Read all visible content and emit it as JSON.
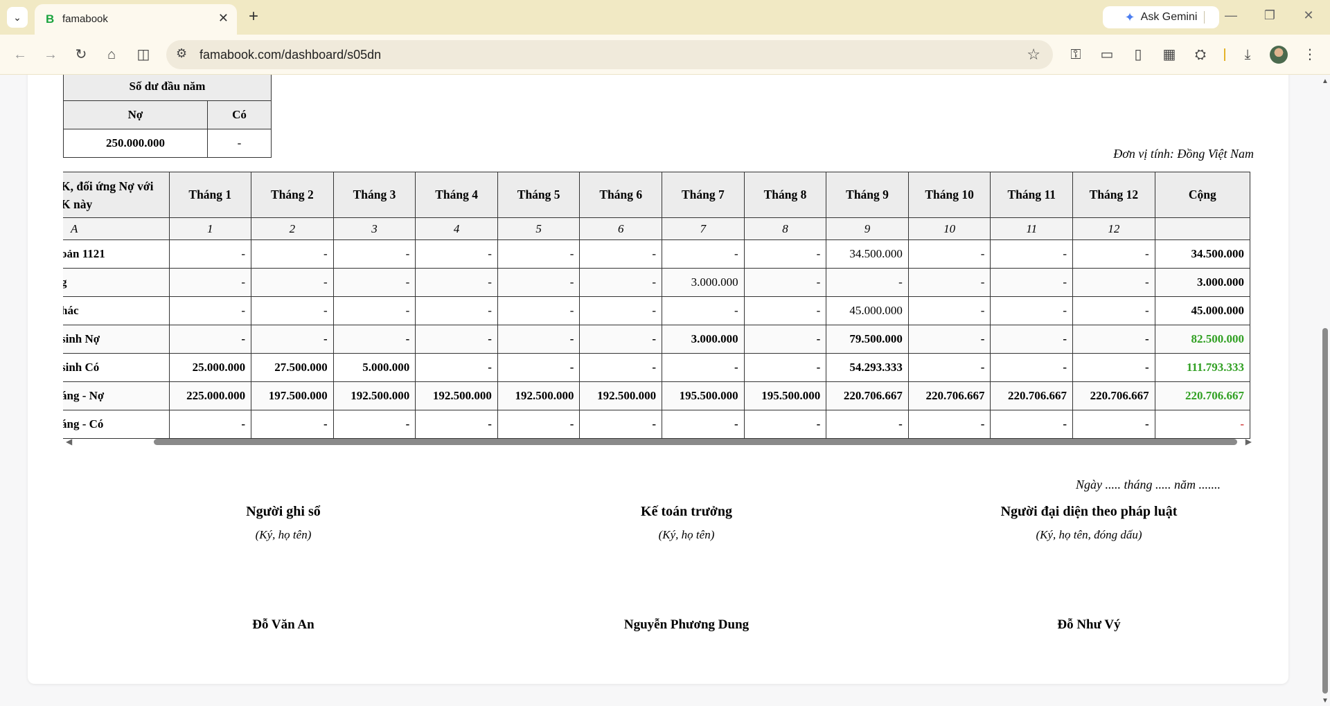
{
  "browser": {
    "tab_title": "famabook",
    "tab_favicon": "B",
    "ask_gemini": "Ask Gemini",
    "url": "famabook.com/dashboard/s05dn"
  },
  "opening_balance": {
    "title": "Số dư đầu năm",
    "debit_label": "Nợ",
    "credit_label": "Có",
    "debit_value": "250.000.000",
    "credit_value": "-"
  },
  "unit_label": "Đơn vị tính: Đồng Việt Nam",
  "ledger": {
    "headers": [
      "K, đối ứng Nợ với",
      "K này",
      "Tháng 1",
      "Tháng 2",
      "Tháng 3",
      "Tháng 4",
      "Tháng 5",
      "Tháng 6",
      "Tháng 7",
      "Tháng 8",
      "Tháng 9",
      "Tháng 10",
      "Tháng 11",
      "Tháng 12",
      "Cộng"
    ],
    "index_row": [
      "A",
      "1",
      "2",
      "3",
      "4",
      "5",
      "6",
      "7",
      "8",
      "9",
      "10",
      "11",
      "12",
      ""
    ],
    "rows": [
      {
        "label": "oản 1121",
        "values": [
          "-",
          "-",
          "-",
          "-",
          "-",
          "-",
          "-",
          "-",
          "34.500.000",
          "-",
          "-",
          "-"
        ],
        "total": "34.500.000"
      },
      {
        "label": "g",
        "values": [
          "-",
          "-",
          "-",
          "-",
          "-",
          "-",
          "3.000.000",
          "-",
          "-",
          "-",
          "-",
          "-"
        ],
        "total": "3.000.000"
      },
      {
        "label": "hác",
        "values": [
          "-",
          "-",
          "-",
          "-",
          "-",
          "-",
          "-",
          "-",
          "45.000.000",
          "-",
          "-",
          "-"
        ],
        "total": "45.000.000"
      },
      {
        "label": "sinh Nợ",
        "values": [
          "-",
          "-",
          "-",
          "-",
          "-",
          "-",
          "3.000.000",
          "-",
          "79.500.000",
          "-",
          "-",
          "-"
        ],
        "total": "82.500.000"
      },
      {
        "label": "sinh Có",
        "values": [
          "25.000.000",
          "27.500.000",
          "5.000.000",
          "-",
          "-",
          "-",
          "-",
          "-",
          "54.293.333",
          "-",
          "-",
          "-"
        ],
        "total": "111.793.333"
      },
      {
        "label": "áng - Nợ",
        "values": [
          "225.000.000",
          "197.500.000",
          "192.500.000",
          "192.500.000",
          "192.500.000",
          "192.500.000",
          "195.500.000",
          "195.500.000",
          "220.706.667",
          "220.706.667",
          "220.706.667",
          "220.706.667"
        ],
        "total": "220.706.667"
      },
      {
        "label": "áng - Có",
        "values": [
          "-",
          "-",
          "-",
          "-",
          "-",
          "-",
          "-",
          "-",
          "-",
          "-",
          "-",
          "-"
        ],
        "total": "-"
      }
    ]
  },
  "date_line": "Ngày ..... tháng ..... năm .......",
  "signatures": [
    {
      "title": "Người ghi sổ",
      "note": "(Ký, họ tên)",
      "name": "Đỗ Văn An"
    },
    {
      "title": "Kế toán trưởng",
      "note": "(Ký, họ tên)",
      "name": "Nguyễn Phương Dung"
    },
    {
      "title": "Người đại diện theo pháp luật",
      "note": "(Ký, họ tên, đóng dấu)",
      "name": "Đỗ Như Vý"
    }
  ],
  "colors": {
    "total_green": "#31a023",
    "total_red": "#d23b3b"
  }
}
